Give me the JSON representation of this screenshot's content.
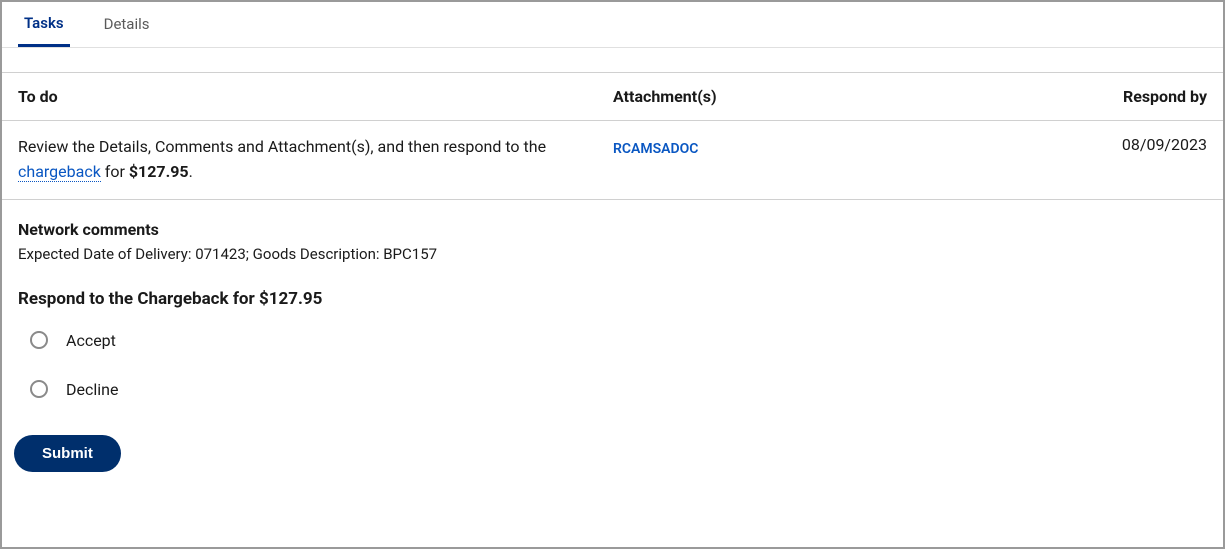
{
  "tabs": {
    "tasks": "Tasks",
    "details": "Details"
  },
  "columns": {
    "todo": "To do",
    "attachments": "Attachment(s)",
    "respond_by": "Respond by"
  },
  "row": {
    "text_pre": "Review the Details, Comments and Attachment(s), and then respond to the ",
    "chargeback_word": "chargeback",
    "text_mid": " for ",
    "amount": "$127.95",
    "text_post": ".",
    "attachment_name": "RCAMSADOC",
    "respond_by": "08/09/2023"
  },
  "network_comments": {
    "heading": "Network comments",
    "body": "Expected Date of Delivery: 071423; Goods Description: BPC157"
  },
  "respond": {
    "heading": "Respond to the Chargeback for $127.95",
    "option_accept": "Accept",
    "option_decline": "Decline",
    "submit": "Submit"
  }
}
